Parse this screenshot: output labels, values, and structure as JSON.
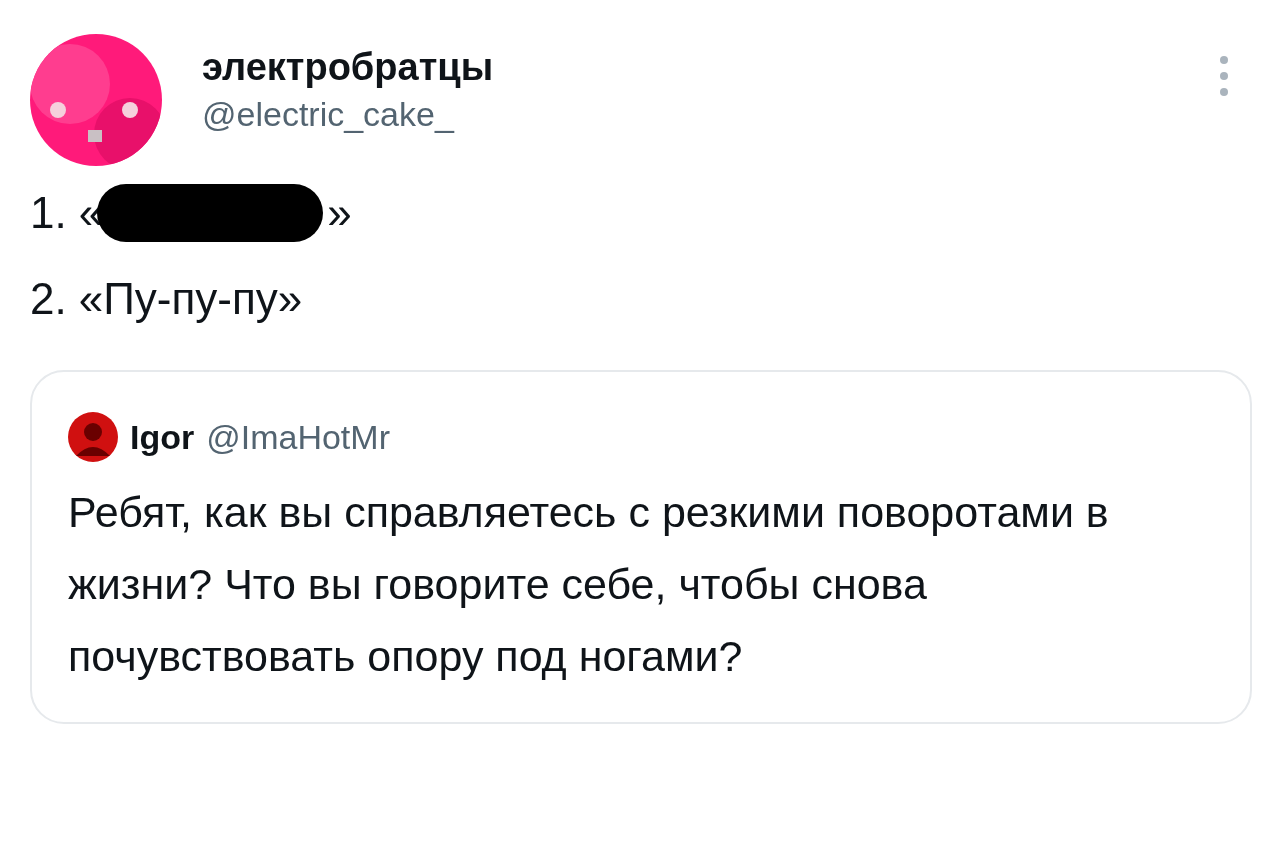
{
  "tweet": {
    "author": {
      "name": "электробратцы",
      "handle": "@electric_cake_"
    },
    "list": [
      {
        "number": "1.",
        "open": "«",
        "close": "»",
        "redacted": true
      },
      {
        "number": "2.",
        "open": "«",
        "text": "Пу-пу-пу",
        "close": "»",
        "redacted": false
      }
    ],
    "quote": {
      "author": {
        "name": "Igor",
        "handle": "@ImaHotMr"
      },
      "text": "Ребят, как вы справляетесь с резкими поворотами в жизни? Что вы говорите себе, чтобы снова почувствовать опору под ногами?"
    }
  }
}
